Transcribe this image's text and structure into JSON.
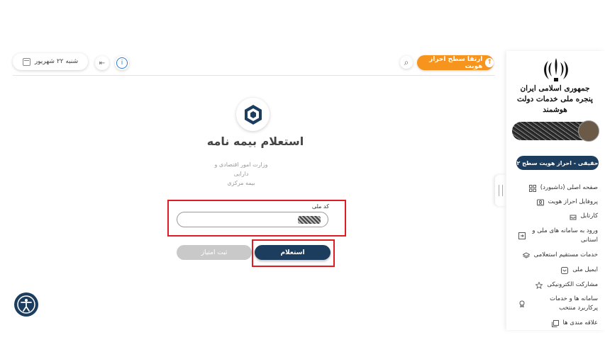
{
  "header": {
    "date_text": "شنبه ۲۲ شهریور",
    "info_symbol": "i",
    "exit_symbol": "⇤",
    "search_symbol": "⌕",
    "upgrade_label": "ارتقا سطح احراز هویت",
    "upgrade_icon_symbol": "↑",
    "accent_color": "#f7941d"
  },
  "main": {
    "title": "استعلام بیمه نامه",
    "org_lines": [
      "وزارت امور اقتصادی و",
      "دارایی",
      "بیمه مرکزی"
    ],
    "field_label": "کد ملی",
    "field_value": "",
    "buttons": {
      "inquiry": "استعلام",
      "submit_rating": "ثبت امتیاز"
    },
    "highlight_color": "#e11b22",
    "primary_color": "#1c3d5e"
  },
  "sidebar": {
    "gov_title_line1": "جمهوری اسلامی ایران",
    "gov_title_line2": "پنجره ملی خدمات دولت هوشمند",
    "level_label": "حقیقی - احراز هویت سطح ۲",
    "items": [
      {
        "label": "صفحه اصلی (داشبورد)",
        "icon": "grid-icon"
      },
      {
        "label": "پروفایل احراز هویت",
        "icon": "profile-card-icon"
      },
      {
        "label": "کارتابل",
        "icon": "inbox-icon"
      },
      {
        "label": "ورود به سامانه های ملی و استانی",
        "icon": "login-window-icon"
      },
      {
        "label": "خدمات مستقیم استعلامی",
        "icon": "layers-icon"
      },
      {
        "label": "ایمیل ملی",
        "icon": "mail-icon"
      },
      {
        "label": "مشارکت الکترونیکی",
        "icon": "star-icon"
      },
      {
        "label": "سامانه ها و خدمات پرکاربرد منتخب",
        "icon": "award-icon"
      },
      {
        "label": "علاقه مندی ها",
        "icon": "bookmark-icon"
      }
    ]
  }
}
